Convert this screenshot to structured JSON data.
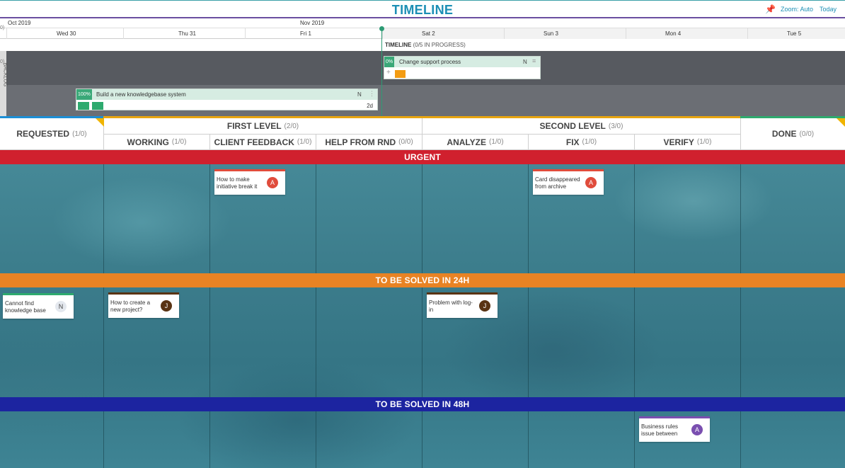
{
  "timeline": {
    "title": "TIMELINE",
    "zoom_label": "Zoom: Auto",
    "today_label": "Today",
    "pin_icon": "pin-icon",
    "months": [
      "Oct 2019",
      "Nov 2019"
    ],
    "days": [
      "Wed 30",
      "Thu 31",
      "Fri 1",
      "Sat 2",
      "Sun 3",
      "Mon 4",
      "Tue 5"
    ],
    "summary_name": "TIMELINE",
    "summary_status": "(0/5 IN PROGRESS)",
    "side_label": "BACKLOG",
    "items": [
      {
        "percent": "0%",
        "name": "Change support process",
        "initial": "N",
        "plus": "+"
      },
      {
        "percent": "100%",
        "name": "Build a new knowledgebase system",
        "initial": "N",
        "duration": "2d"
      }
    ]
  },
  "board": {
    "columns": {
      "requested": {
        "label": "REQUESTED",
        "count": "(1/0)"
      },
      "first_level": {
        "label": "FIRST LEVEL",
        "count": "(2/0)"
      },
      "working": {
        "label": "WORKING",
        "count": "(1/0)"
      },
      "client_feedback": {
        "label": "CLIENT FEEDBACK",
        "count": "(1/0)"
      },
      "help_from_rnd": {
        "label": "HELP FROM RND",
        "count": "(0/0)"
      },
      "second_level": {
        "label": "SECOND LEVEL",
        "count": "(3/0)"
      },
      "analyze": {
        "label": "ANALYZE",
        "count": "(1/0)"
      },
      "fix": {
        "label": "FIX",
        "count": "(1/0)"
      },
      "verify": {
        "label": "VERIFY",
        "count": "(1/0)"
      },
      "done": {
        "label": "DONE",
        "count": "(0/0)"
      }
    },
    "swimlanes": [
      {
        "label": "URGENT",
        "color": "#d0202e"
      },
      {
        "label": "TO BE SOLVED IN 24H",
        "color": "#e88324"
      },
      {
        "label": "TO BE SOLVED IN 48H",
        "color": "#1c24a0"
      }
    ],
    "cards": [
      {
        "title": "How to make initiative break it",
        "avatar": "A",
        "color": "#e04c3c"
      },
      {
        "title": "Card disappeared from archive",
        "avatar": "A",
        "color": "#e04c3c"
      },
      {
        "title": "Cannot find knowledge base",
        "avatar": "N",
        "color": "#2eaa6e"
      },
      {
        "title": "How to create a new project?",
        "avatar": "J",
        "color": "#5a3414"
      },
      {
        "title": "Problem with log-in",
        "avatar": "J",
        "color": "#5a3414"
      },
      {
        "title": "Business rules issue between",
        "avatar": "A",
        "color": "#7a4fb0"
      }
    ]
  }
}
